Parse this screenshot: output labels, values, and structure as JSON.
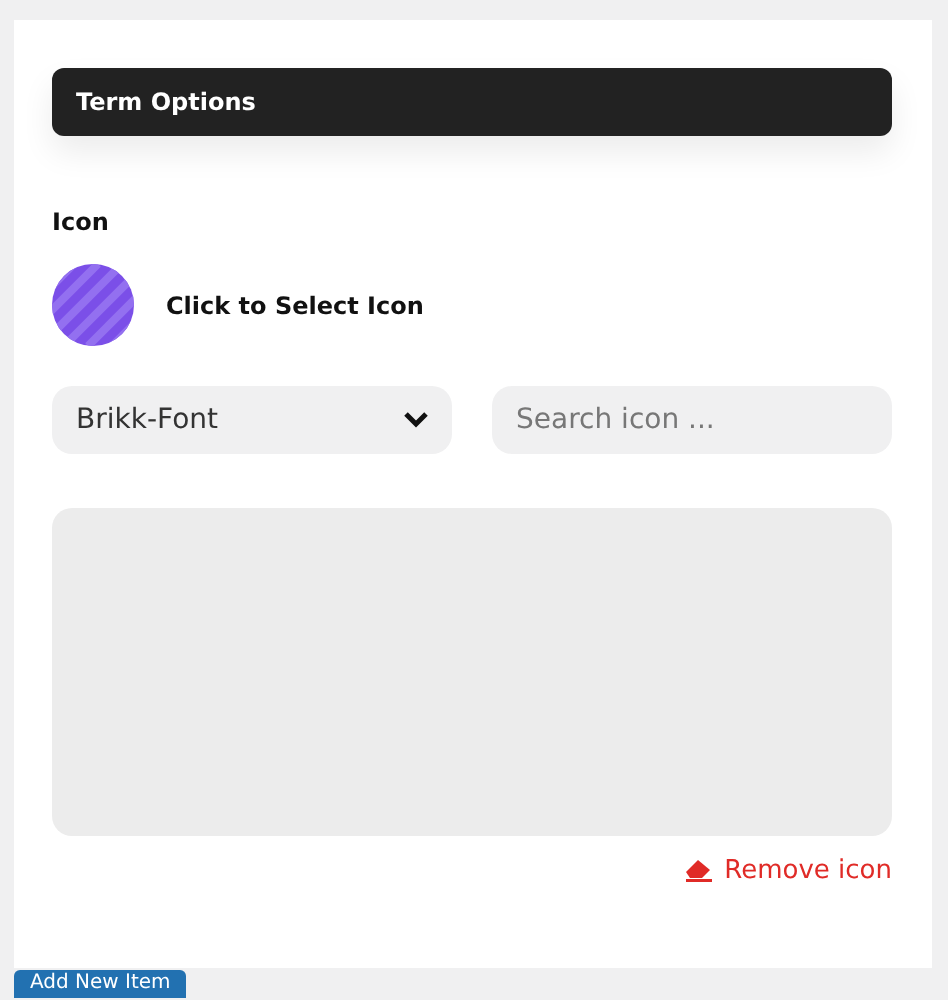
{
  "header": {
    "title": "Term Options"
  },
  "icon_field": {
    "label": "Icon",
    "prompt": "Click to Select Icon"
  },
  "font_select": {
    "value": "Brikk-Font"
  },
  "search": {
    "placeholder": "Search icon ..."
  },
  "remove_link": {
    "label": "Remove icon"
  },
  "add_button": {
    "label": "Add New Item"
  }
}
